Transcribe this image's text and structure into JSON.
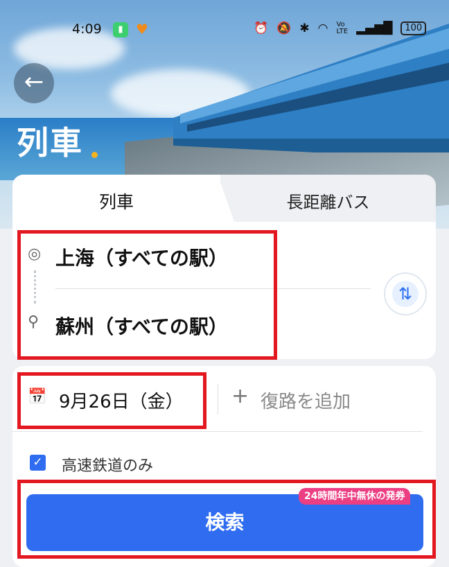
{
  "status_bar": {
    "time": "4:09",
    "battery": "100",
    "icons": [
      "app-green-icon",
      "app-orange-heart-icon",
      "alarm-icon",
      "mute-icon",
      "bluetooth-icon",
      "wifi-icon",
      "volte-icon",
      "signal-icon",
      "battery-icon"
    ]
  },
  "header": {
    "title": "列車",
    "back_icon": "arrow-left-icon"
  },
  "tabs": [
    {
      "label": "列車",
      "active": true
    },
    {
      "label": "長距離バス",
      "active": false
    }
  ],
  "route": {
    "from": "上海（すべての駅）",
    "to": "蘇州（すべての駅）",
    "from_icon": "origin-circle-icon",
    "to_icon": "location-pin-icon",
    "swap_icon": "train-swap-icon"
  },
  "date": {
    "value": "9月26日（金）",
    "icon": "calendar-icon"
  },
  "return_trip": {
    "label": "復路を追加",
    "icon": "plus-icon"
  },
  "filter": {
    "label": "高速鉄道のみ",
    "checked": true
  },
  "search": {
    "label": "検索",
    "badge": "24時間年中無休の発券"
  },
  "colors": {
    "primary": "#2f6cf0",
    "badge": "#ec3f83",
    "highlight": "#e3171f",
    "accent_dot": "#f5b320"
  }
}
